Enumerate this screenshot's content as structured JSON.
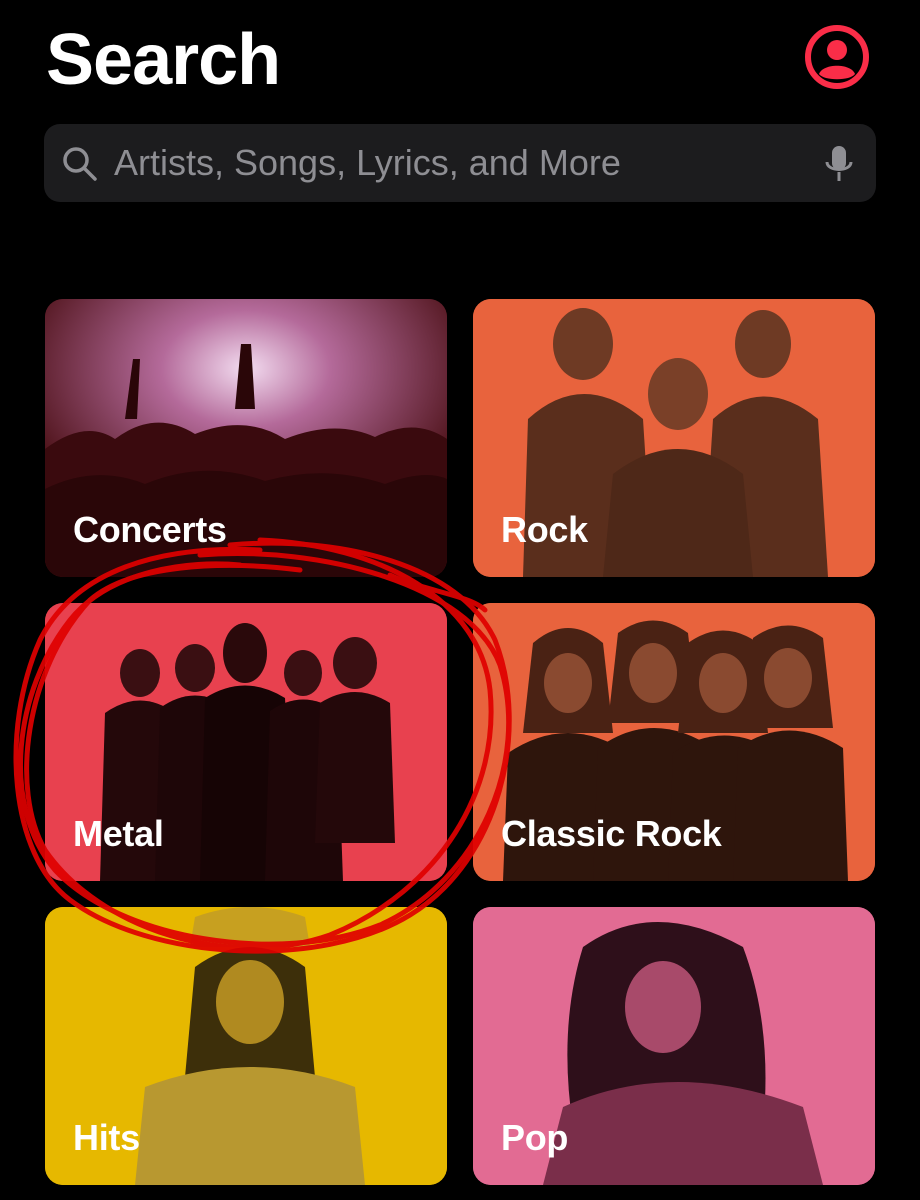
{
  "header": {
    "title": "Search"
  },
  "search": {
    "placeholder": "Artists, Songs, Lyrics, and More"
  },
  "icons": {
    "profile": "person-circle-icon",
    "search": "magnifying-glass-icon",
    "mic": "microphone-icon"
  },
  "colors": {
    "accent": "#fa2d48",
    "concerts": "#5a1215",
    "rock": "#e8633d",
    "metal": "#e8414f",
    "classic_rock": "#e8633d",
    "hits": "#e6b800",
    "pop": "#e26b93",
    "annotation": "#e00000"
  },
  "categories": [
    {
      "label": "Concerts"
    },
    {
      "label": "Rock"
    },
    {
      "label": "Metal"
    },
    {
      "label": "Classic Rock"
    },
    {
      "label": "Hits"
    },
    {
      "label": "Pop"
    }
  ]
}
